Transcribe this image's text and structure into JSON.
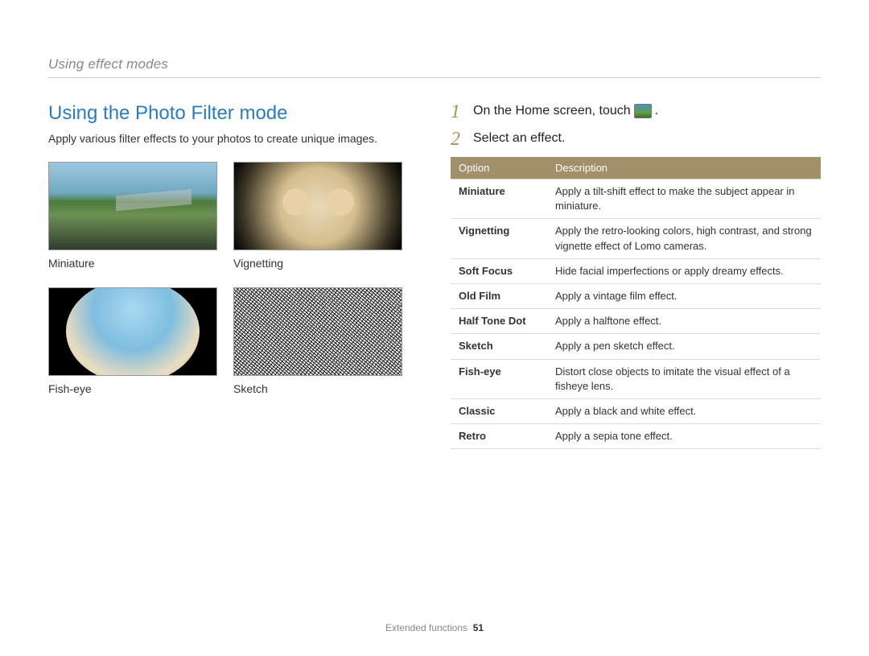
{
  "breadcrumb": "Using effect modes",
  "section_title": "Using the Photo Filter mode",
  "intro": "Apply various filter effects to your photos to create unique images.",
  "samples": [
    {
      "label": "Miniature"
    },
    {
      "label": "Vignetting"
    },
    {
      "label": "Fish-eye"
    },
    {
      "label": "Sketch"
    }
  ],
  "steps": [
    {
      "num": "1",
      "text_before": "On the Home screen, touch ",
      "text_after": "."
    },
    {
      "num": "2",
      "text_before": "Select an effect.",
      "text_after": ""
    }
  ],
  "table": {
    "headers": {
      "option": "Option",
      "description": "Description"
    },
    "rows": [
      {
        "name": "Miniature",
        "desc": "Apply a tilt-shift effect to make the subject appear in miniature."
      },
      {
        "name": "Vignetting",
        "desc": "Apply the retro-looking colors, high contrast, and strong vignette effect of Lomo cameras."
      },
      {
        "name": "Soft Focus",
        "desc": "Hide facial imperfections or apply dreamy effects."
      },
      {
        "name": "Old Film",
        "desc": "Apply a vintage film effect."
      },
      {
        "name": "Half Tone Dot",
        "desc": "Apply a halftone effect."
      },
      {
        "name": "Sketch",
        "desc": "Apply a pen sketch effect."
      },
      {
        "name": "Fish-eye",
        "desc": "Distort close objects to imitate the visual effect of a fisheye lens."
      },
      {
        "name": "Classic",
        "desc": "Apply a black and white effect."
      },
      {
        "name": "Retro",
        "desc": "Apply a sepia tone effect."
      }
    ]
  },
  "footer": {
    "section": "Extended functions",
    "page": "51"
  }
}
